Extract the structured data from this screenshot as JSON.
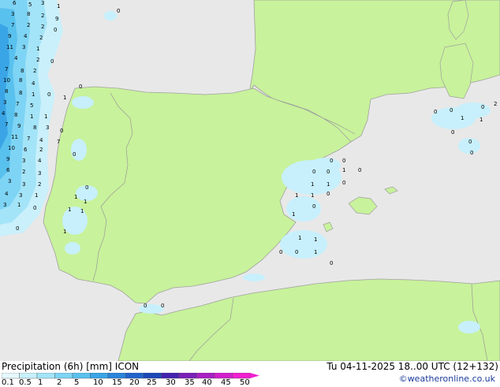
{
  "title": "Precipitation (6h) [mm] ICON",
  "timestamp": "Tu 04-11-2025 18..00 UTC (12+132)",
  "credit": "©weatheronline.co.uk",
  "colors": {
    "sea": "#e8e8e8",
    "land": "#c8f29b",
    "coast": "#a0a0a0",
    "border": "#9a9a9a"
  },
  "legend": {
    "ticks": [
      "0.1",
      "0.5",
      "1",
      "2",
      "5",
      "10",
      "15",
      "20",
      "25",
      "30",
      "35",
      "40",
      "45",
      "50"
    ],
    "colors": [
      "#e6f9ff",
      "#c7f0fc",
      "#a4e4f8",
      "#7ed4f4",
      "#59c1ee",
      "#3aa5e6",
      "#2a84db",
      "#2063cc",
      "#1b47b8",
      "#4422b0",
      "#7a1fb8",
      "#a81fc4",
      "#d21fcc",
      "#f020d0"
    ]
  },
  "map_labels": [
    "0",
    "1",
    "2",
    "3",
    "4",
    "5",
    "6",
    "7",
    "8",
    "9",
    "10",
    "11"
  ]
}
